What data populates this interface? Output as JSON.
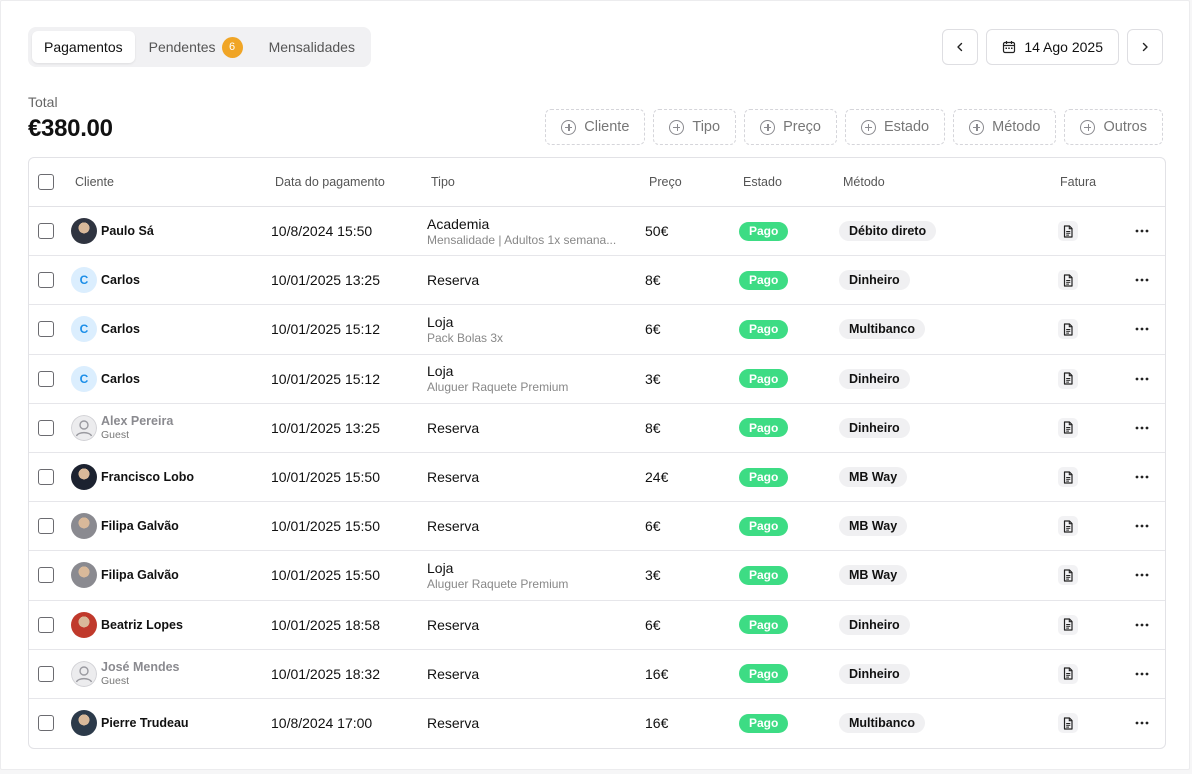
{
  "tabs": [
    {
      "label": "Pagamentos",
      "active": true
    },
    {
      "label": "Pendentes",
      "badge": "6"
    },
    {
      "label": "Mensalidades"
    }
  ],
  "date": {
    "label": "14 Ago 2025"
  },
  "total": {
    "label": "Total",
    "value": "€380.00"
  },
  "filters": [
    "Cliente",
    "Tipo",
    "Preço",
    "Estado",
    "Método",
    "Outros"
  ],
  "columns": {
    "cliente": "Cliente",
    "data": "Data do pagamento",
    "tipo": "Tipo",
    "preco": "Preço",
    "estado": "Estado",
    "metodo": "Método",
    "fatura": "Fatura"
  },
  "colors": {
    "accent_badge": "#f0a526",
    "pago": "#3ddc84",
    "avatar_letter_bg": "#dbeefe",
    "avatar_letter_fg": "#1b8ee8"
  },
  "rows": [
    {
      "avatar": "photo",
      "avatar_color": "#2f3440",
      "name": "Paulo Sá",
      "sub": "",
      "date": "10/8/2024 15:50",
      "tipo": "Academia",
      "tipo_sub": "Mensalidade | Adultos 1x semana...",
      "preco": "50€",
      "estado": "Pago",
      "metodo": "Débito direto"
    },
    {
      "avatar": "letter",
      "letter": "C",
      "name": "Carlos",
      "sub": "",
      "date": "10/01/2025 13:25",
      "tipo": "Reserva",
      "tipo_sub": "",
      "preco": "8€",
      "estado": "Pago",
      "metodo": "Dinheiro"
    },
    {
      "avatar": "letter",
      "letter": "C",
      "name": "Carlos",
      "sub": "",
      "date": "10/01/2025 15:12",
      "tipo": "Loja",
      "tipo_sub": "Pack Bolas 3x",
      "preco": "6€",
      "estado": "Pago",
      "metodo": "Multibanco"
    },
    {
      "avatar": "letter",
      "letter": "C",
      "name": "Carlos",
      "sub": "",
      "date": "10/01/2025 15:12",
      "tipo": "Loja",
      "tipo_sub": "Aluguer Raquete Premium",
      "preco": "3€",
      "estado": "Pago",
      "metodo": "Dinheiro"
    },
    {
      "avatar": "guest",
      "name": "Alex Pereira",
      "sub": "Guest",
      "date": "10/01/2025 13:25",
      "tipo": "Reserva",
      "tipo_sub": "",
      "preco": "8€",
      "estado": "Pago",
      "metodo": "Dinheiro"
    },
    {
      "avatar": "photo",
      "avatar_color": "#1c2230",
      "name": "Francisco Lobo",
      "sub": "",
      "date": "10/01/2025 15:50",
      "tipo": "Reserva",
      "tipo_sub": "",
      "preco": "24€",
      "estado": "Pago",
      "metodo": "MB Way"
    },
    {
      "avatar": "photo",
      "avatar_color": "#8a8a90",
      "name": "Filipa Galvão",
      "sub": "",
      "date": "10/01/2025 15:50",
      "tipo": "Reserva",
      "tipo_sub": "",
      "preco": "6€",
      "estado": "Pago",
      "metodo": "MB Way"
    },
    {
      "avatar": "photo",
      "avatar_color": "#8a8a90",
      "name": "Filipa Galvão",
      "sub": "",
      "date": "10/01/2025 15:50",
      "tipo": "Loja",
      "tipo_sub": "Aluguer Raquete Premium",
      "preco": "3€",
      "estado": "Pago",
      "metodo": "MB Way"
    },
    {
      "avatar": "photo",
      "avatar_color": "#c0392b",
      "name": "Beatriz Lopes",
      "sub": "",
      "date": "10/01/2025 18:58",
      "tipo": "Reserva",
      "tipo_sub": "",
      "preco": "6€",
      "estado": "Pago",
      "metodo": "Dinheiro"
    },
    {
      "avatar": "guest",
      "name": "José Mendes",
      "sub": "Guest",
      "date": "10/01/2025 18:32",
      "tipo": "Reserva",
      "tipo_sub": "",
      "preco": "16€",
      "estado": "Pago",
      "metodo": "Dinheiro"
    },
    {
      "avatar": "photo",
      "avatar_color": "#2c3a4a",
      "name": "Pierre Trudeau",
      "sub": "",
      "date": "10/8/2024 17:00",
      "tipo": "Reserva",
      "tipo_sub": "",
      "preco": "16€",
      "estado": "Pago",
      "metodo": "Multibanco"
    }
  ]
}
